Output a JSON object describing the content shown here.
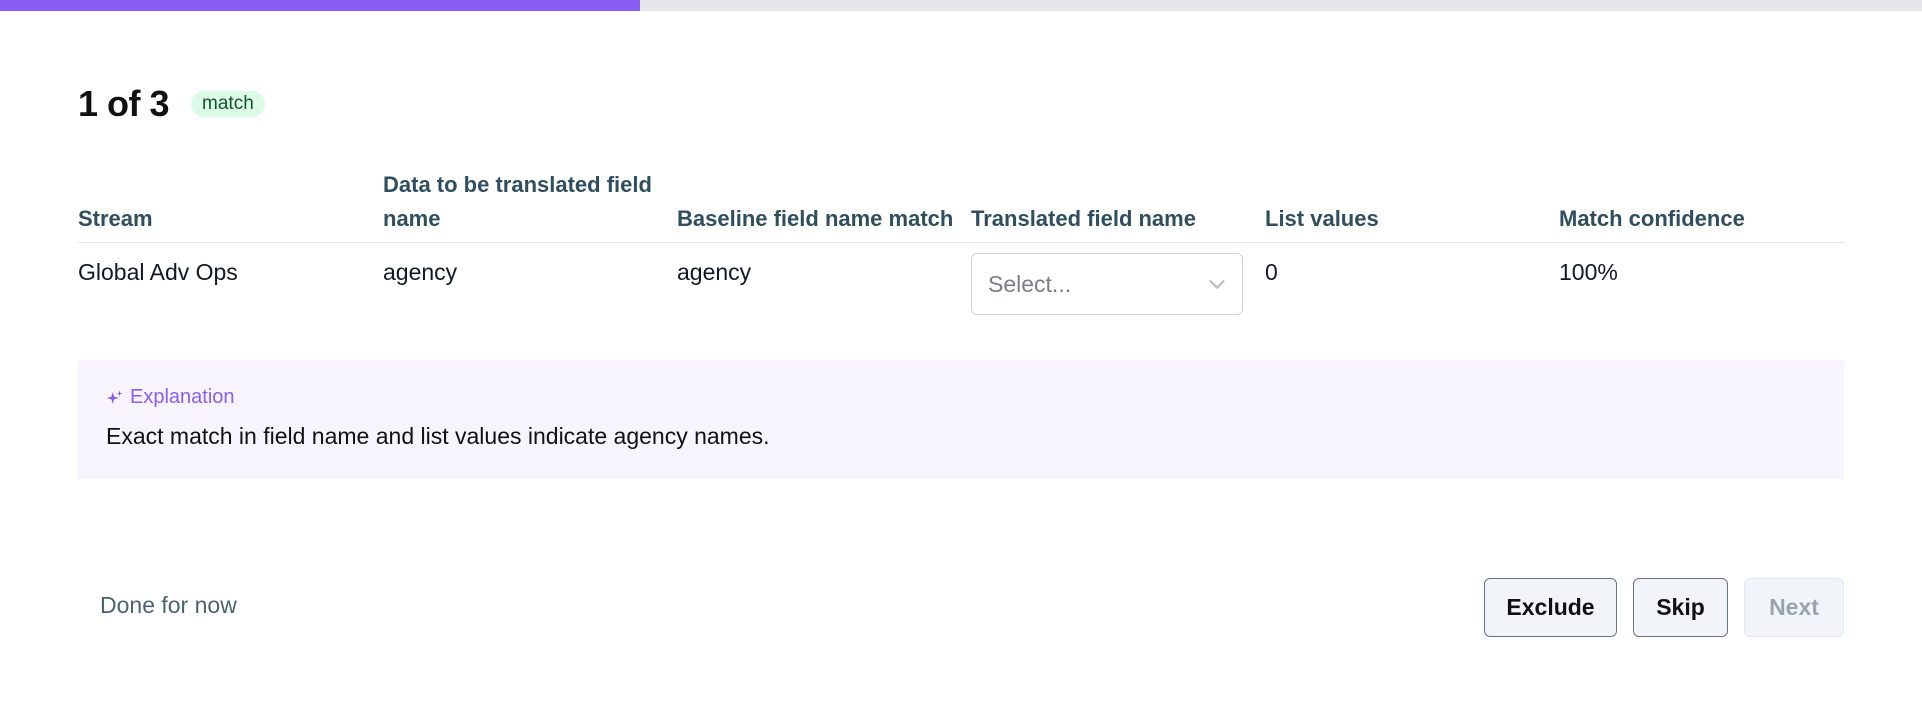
{
  "progress": {
    "fraction": 0.333,
    "color": "#8b5cf6"
  },
  "header": {
    "title": "1 of 3",
    "badge": "match"
  },
  "table": {
    "columns": [
      "Stream",
      "Data to be translated field name",
      "Baseline field name match",
      "Translated field name",
      "List values",
      "Match confidence"
    ],
    "row": {
      "stream": "Global Adv Ops",
      "source_field": "agency",
      "baseline_match": "agency",
      "translated_field_placeholder": "Select...",
      "list_values": "0",
      "confidence": "100%"
    }
  },
  "explanation": {
    "icon": "sparkle-icon",
    "label": "Explanation",
    "text": "Exact match in field name and list values indicate agency names."
  },
  "footer": {
    "done_label": "Done for now",
    "exclude_label": "Exclude",
    "skip_label": "Skip",
    "next_label": "Next"
  }
}
